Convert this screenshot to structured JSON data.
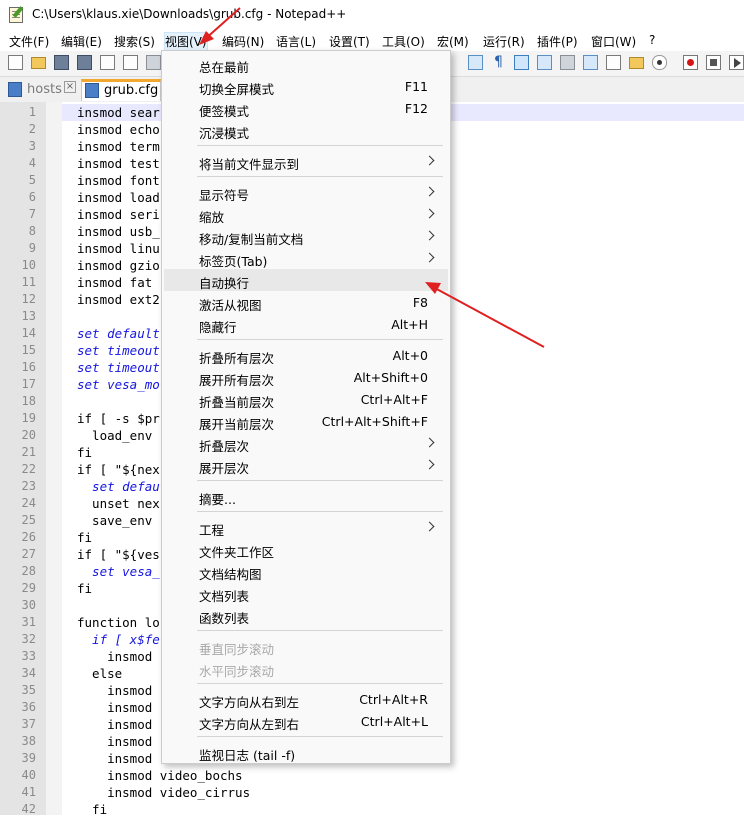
{
  "window": {
    "title": "C:\\Users\\klaus.xie\\Downloads\\grub.cfg - Notepad++"
  },
  "menubar": {
    "items": [
      {
        "label": "文件(F)"
      },
      {
        "label": "编辑(E)"
      },
      {
        "label": "搜索(S)"
      },
      {
        "label": "视图(V)"
      },
      {
        "label": "编码(N)"
      },
      {
        "label": "语言(L)"
      },
      {
        "label": "设置(T)"
      },
      {
        "label": "工具(O)"
      },
      {
        "label": "宏(M)"
      },
      {
        "label": "运行(R)"
      },
      {
        "label": "插件(P)"
      },
      {
        "label": "窗口(W)"
      },
      {
        "label": "?"
      }
    ],
    "active_index": 3
  },
  "toolbar": {
    "icons": [
      "new-file-icon",
      "open-folder-icon",
      "save-icon",
      "save-all-icon",
      "close-icon",
      "close-all-icon",
      "print-icon",
      "word-wrap-icon",
      "show-all-chars-icon",
      "indent-guide-icon",
      "doc-map-icon",
      "function-list-icon",
      "folder-workspace-icon",
      "doc-list-icon",
      "monitor-icon",
      "record-macro-icon",
      "stop-macro-icon",
      "play-macro-icon"
    ]
  },
  "tabs": [
    {
      "label": "hosts",
      "active": false,
      "close": "×"
    },
    {
      "label": "grub.cfg",
      "active": true
    }
  ],
  "editor": {
    "line_numbers": [
      "1",
      "2",
      "3",
      "4",
      "5",
      "6",
      "7",
      "8",
      "9",
      "10",
      "11",
      "12",
      "13",
      "14",
      "15",
      "16",
      "17",
      "18",
      "19",
      "20",
      "21",
      "22",
      "23",
      "24",
      "25",
      "26",
      "27",
      "28",
      "29",
      "30",
      "31",
      "32",
      "33",
      "34",
      "35",
      "36",
      "37",
      "38",
      "39",
      "40",
      "41",
      "42"
    ],
    "lines": [
      "insmod sear",
      "insmod echo",
      "insmod term",
      "insmod test",
      "insmod font",
      "insmod load",
      "insmod seri",
      "insmod usb_",
      "insmod linu",
      "insmod gzio",
      "insmod fat",
      "insmod ext2",
      "",
      "set default",
      "set timeout",
      "set timeout",
      "set vesa_mo",
      "",
      "if [ -s $pr",
      "  load_env",
      "fi",
      "if [ \"${nex",
      "  set defau",
      "  unset nex",
      "  save_env",
      "fi",
      "if [ \"${ves",
      "  set vesa_",
      "fi",
      "",
      "function lo",
      "  if [ x$fe",
      "    insmod",
      "  else",
      "    insmod",
      "    insmod",
      "    insmod",
      "    insmod",
      "    insmod",
      "    insmod video_bochs",
      "    insmod video_cirrus",
      "  fi"
    ],
    "keyword_lines": [
      14,
      15,
      16,
      17,
      23,
      28,
      32
    ]
  },
  "view_menu": {
    "groups": [
      [
        {
          "label": "总在最前",
          "shortcut": ""
        },
        {
          "label": "切换全屏模式",
          "shortcut": "F11"
        },
        {
          "label": "便签模式",
          "shortcut": "F12"
        },
        {
          "label": "沉浸模式",
          "shortcut": ""
        }
      ],
      [
        {
          "label": "将当前文件显示到",
          "submenu": true
        }
      ],
      [
        {
          "label": "显示符号",
          "submenu": true
        },
        {
          "label": "缩放",
          "submenu": true
        },
        {
          "label": "移动/复制当前文档",
          "submenu": true
        },
        {
          "label": "标签页(Tab)",
          "submenu": true
        },
        {
          "label": "自动换行",
          "shortcut": "",
          "highlighted": true
        },
        {
          "label": "激活从视图",
          "shortcut": "F8"
        },
        {
          "label": "隐藏行",
          "shortcut": "Alt+H"
        }
      ],
      [
        {
          "label": "折叠所有层次",
          "shortcut": "Alt+0"
        },
        {
          "label": "展开所有层次",
          "shortcut": "Alt+Shift+0"
        },
        {
          "label": "折叠当前层次",
          "shortcut": "Ctrl+Alt+F"
        },
        {
          "label": "展开当前层次",
          "shortcut": "Ctrl+Alt+Shift+F"
        },
        {
          "label": "折叠层次",
          "submenu": true
        },
        {
          "label": "展开层次",
          "submenu": true
        }
      ],
      [
        {
          "label": "摘要...",
          "shortcut": ""
        }
      ],
      [
        {
          "label": "工程",
          "submenu": true
        },
        {
          "label": "文件夹工作区",
          "shortcut": ""
        },
        {
          "label": "文档结构图",
          "shortcut": ""
        },
        {
          "label": "文档列表",
          "shortcut": ""
        },
        {
          "label": "函数列表",
          "shortcut": ""
        }
      ],
      [
        {
          "label": "垂直同步滚动",
          "disabled": true
        },
        {
          "label": "水平同步滚动",
          "disabled": true
        }
      ],
      [
        {
          "label": "文字方向从右到左",
          "shortcut": "Ctrl+Alt+R"
        },
        {
          "label": "文字方向从左到右",
          "shortcut": "Ctrl+Alt+L"
        }
      ],
      [
        {
          "label": "监视日志 (tail -f)",
          "shortcut": ""
        }
      ]
    ]
  },
  "colors": {
    "annotation_arrow": "#e02020",
    "keyword": "#1515e0",
    "current_line": "#e8e8ff",
    "tab_accent": "#f0a830",
    "menu_hover": "#e8e8e8"
  }
}
